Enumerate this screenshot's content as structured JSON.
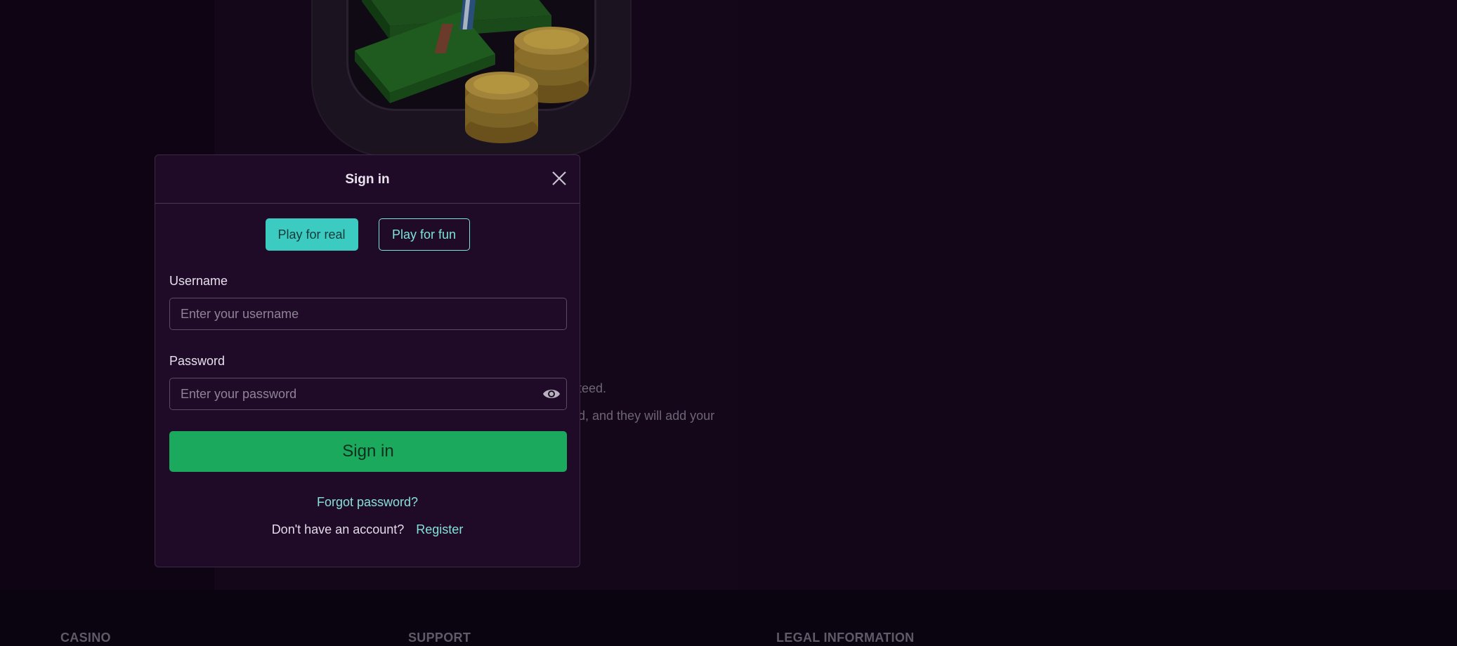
{
  "background": {
    "partial_line_1": "teed.",
    "partial_line_2": "d, and they will add your"
  },
  "footer": {
    "casino": "CASINO",
    "support": "SUPPORT",
    "legal": "LEGAL INFORMATION"
  },
  "modal": {
    "title": "Sign in",
    "tabs": {
      "real": "Play for real",
      "fun": "Play for fun"
    },
    "username": {
      "label": "Username",
      "placeholder": "Enter your username"
    },
    "password": {
      "label": "Password",
      "placeholder": "Enter your password"
    },
    "submit": "Sign in",
    "forgot": "Forgot password?",
    "no_account": "Don't have an account?",
    "register": "Register"
  },
  "colors": {
    "accent": "#3ccbc1",
    "primary_button": "#1aa95d",
    "modal_bg": "#1f0a27"
  },
  "icons": {
    "close": "close-icon",
    "eye": "eye-icon"
  }
}
